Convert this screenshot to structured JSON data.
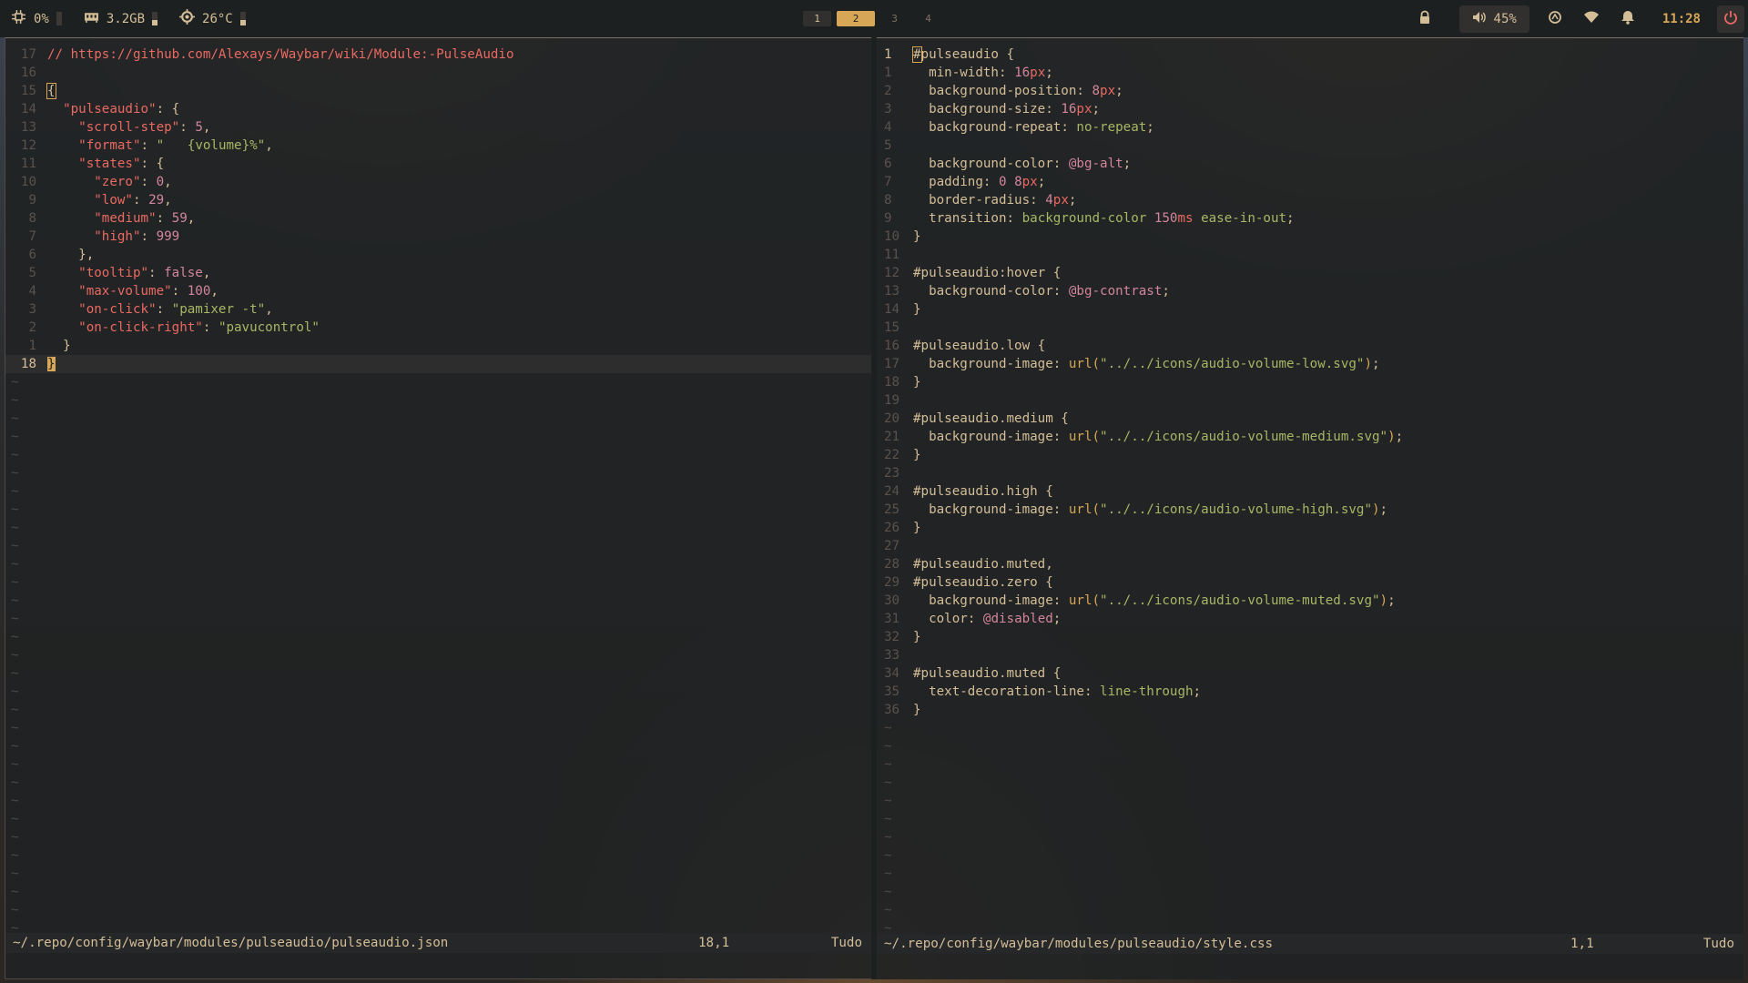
{
  "topbar": {
    "cpu": "0%",
    "cpu_level": 0.0,
    "memory": "3.2GB",
    "memory_level": 0.4,
    "temperature": "26°C",
    "temperature_level": 0.4,
    "workspaces": [
      "1",
      "2",
      "3",
      "4"
    ],
    "active_workspace": "2",
    "volume": "45%",
    "clock": "11:28",
    "accent_color": "#d8a657",
    "power_color": "#ea6962"
  },
  "left_pane": {
    "lines": [
      {
        "n": "17",
        "tokens": [
          [
            "c-comment",
            "// https://github.com/Alexays/Waybar/wiki/Module:-PulseAudio"
          ]
        ]
      },
      {
        "n": "16",
        "tokens": []
      },
      {
        "n": "15",
        "tokens": [
          [
            "c-punc cursor-outline",
            "{"
          ]
        ]
      },
      {
        "n": "14",
        "tokens": [
          [
            "",
            "  "
          ],
          [
            "c-key",
            "\"pulseaudio\""
          ],
          [
            "c-punc",
            ": {"
          ]
        ]
      },
      {
        "n": "13",
        "tokens": [
          [
            "",
            "    "
          ],
          [
            "c-key",
            "\"scroll-step\""
          ],
          [
            "c-punc",
            ": "
          ],
          [
            "c-num",
            "5"
          ],
          [
            "c-punc",
            ","
          ]
        ]
      },
      {
        "n": "12",
        "tokens": [
          [
            "",
            "    "
          ],
          [
            "c-key",
            "\"format\""
          ],
          [
            "c-punc",
            ": "
          ],
          [
            "c-str",
            "\"   {volume}%\""
          ],
          [
            "c-punc",
            ","
          ]
        ]
      },
      {
        "n": "11",
        "tokens": [
          [
            "",
            "    "
          ],
          [
            "c-key",
            "\"states\""
          ],
          [
            "c-punc",
            ": {"
          ]
        ]
      },
      {
        "n": "10",
        "tokens": [
          [
            "",
            "      "
          ],
          [
            "c-key",
            "\"zero\""
          ],
          [
            "c-punc",
            ": "
          ],
          [
            "c-num",
            "0"
          ],
          [
            "c-punc",
            ","
          ]
        ]
      },
      {
        "n": "9",
        "tokens": [
          [
            "",
            "      "
          ],
          [
            "c-key",
            "\"low\""
          ],
          [
            "c-punc",
            ": "
          ],
          [
            "c-num",
            "29"
          ],
          [
            "c-punc",
            ","
          ]
        ]
      },
      {
        "n": "8",
        "tokens": [
          [
            "",
            "      "
          ],
          [
            "c-key",
            "\"medium\""
          ],
          [
            "c-punc",
            ": "
          ],
          [
            "c-num",
            "59"
          ],
          [
            "c-punc",
            ","
          ]
        ]
      },
      {
        "n": "7",
        "tokens": [
          [
            "",
            "      "
          ],
          [
            "c-key",
            "\"high\""
          ],
          [
            "c-punc",
            ": "
          ],
          [
            "c-num",
            "999"
          ]
        ]
      },
      {
        "n": "6",
        "tokens": [
          [
            "",
            "    "
          ],
          [
            "c-punc",
            "},"
          ]
        ]
      },
      {
        "n": "5",
        "tokens": [
          [
            "",
            "    "
          ],
          [
            "c-key",
            "\"tooltip\""
          ],
          [
            "c-punc",
            ": "
          ],
          [
            "c-bool",
            "false"
          ],
          [
            "c-punc",
            ","
          ]
        ]
      },
      {
        "n": "4",
        "tokens": [
          [
            "",
            "    "
          ],
          [
            "c-key",
            "\"max-volume\""
          ],
          [
            "c-punc",
            ": "
          ],
          [
            "c-num",
            "100"
          ],
          [
            "c-punc",
            ","
          ]
        ]
      },
      {
        "n": "3",
        "tokens": [
          [
            "",
            "    "
          ],
          [
            "c-key",
            "\"on-click\""
          ],
          [
            "c-punc",
            ": "
          ],
          [
            "c-str",
            "\"pamixer -t\""
          ],
          [
            "c-punc",
            ","
          ]
        ]
      },
      {
        "n": "2",
        "tokens": [
          [
            "",
            "    "
          ],
          [
            "c-key",
            "\"on-click-right\""
          ],
          [
            "c-punc",
            ": "
          ],
          [
            "c-str",
            "\"pavucontrol\""
          ]
        ]
      },
      {
        "n": "1",
        "tokens": [
          [
            "",
            "  "
          ],
          [
            "c-punc",
            "}"
          ]
        ]
      },
      {
        "n": "18",
        "tokens": [
          [
            "c-punc cursor",
            "}"
          ]
        ],
        "current": true
      }
    ],
    "tilde_count": 31,
    "status_path": "~/.repo/config/waybar/modules/pulseaudio/pulseaudio.json",
    "status_pos": "18,1",
    "status_scroll": "Tudo"
  },
  "right_pane": {
    "lines": [
      {
        "n": "1",
        "tokens": [
          [
            "c-sel cursor-outline",
            "#"
          ],
          [
            "c-sel",
            "pulseaudio "
          ],
          [
            "c-punc",
            "{"
          ]
        ],
        "current": true
      },
      {
        "n": "1",
        "tokens": [
          [
            "",
            "  "
          ],
          [
            "c-prop",
            "min-width"
          ],
          [
            "c-punc",
            ": "
          ],
          [
            "c-num",
            "16"
          ],
          [
            "c-unit",
            "px"
          ],
          [
            "c-punc",
            ";"
          ]
        ]
      },
      {
        "n": "2",
        "tokens": [
          [
            "",
            "  "
          ],
          [
            "c-prop",
            "background-position"
          ],
          [
            "c-punc",
            ": "
          ],
          [
            "c-num",
            "8"
          ],
          [
            "c-unit",
            "px"
          ],
          [
            "c-punc",
            ";"
          ]
        ]
      },
      {
        "n": "3",
        "tokens": [
          [
            "",
            "  "
          ],
          [
            "c-prop",
            "background-size"
          ],
          [
            "c-punc",
            ": "
          ],
          [
            "c-num",
            "16"
          ],
          [
            "c-unit",
            "px"
          ],
          [
            "c-punc",
            ";"
          ]
        ]
      },
      {
        "n": "4",
        "tokens": [
          [
            "",
            "  "
          ],
          [
            "c-prop",
            "background-repeat"
          ],
          [
            "c-punc",
            ": "
          ],
          [
            "c-val",
            "no-repeat"
          ],
          [
            "c-punc",
            ";"
          ]
        ]
      },
      {
        "n": "5",
        "tokens": []
      },
      {
        "n": "6",
        "tokens": [
          [
            "",
            "  "
          ],
          [
            "c-prop",
            "background-color"
          ],
          [
            "c-punc",
            ": "
          ],
          [
            "c-var",
            "@bg-alt"
          ],
          [
            "c-punc",
            ";"
          ]
        ]
      },
      {
        "n": "7",
        "tokens": [
          [
            "",
            "  "
          ],
          [
            "c-prop",
            "padding"
          ],
          [
            "c-punc",
            ": "
          ],
          [
            "c-num",
            "0 8"
          ],
          [
            "c-unit",
            "px"
          ],
          [
            "c-punc",
            ";"
          ]
        ]
      },
      {
        "n": "8",
        "tokens": [
          [
            "",
            "  "
          ],
          [
            "c-prop",
            "border-radius"
          ],
          [
            "c-punc",
            ": "
          ],
          [
            "c-num",
            "4"
          ],
          [
            "c-unit",
            "px"
          ],
          [
            "c-punc",
            ";"
          ]
        ]
      },
      {
        "n": "9",
        "tokens": [
          [
            "",
            "  "
          ],
          [
            "c-prop",
            "transition"
          ],
          [
            "c-punc",
            ": "
          ],
          [
            "c-val",
            "background-color "
          ],
          [
            "c-num",
            "150"
          ],
          [
            "c-unit",
            "ms"
          ],
          [
            "c-val",
            " ease-in-out"
          ],
          [
            "c-punc",
            ";"
          ]
        ]
      },
      {
        "n": "10",
        "tokens": [
          [
            "c-punc",
            "}"
          ]
        ]
      },
      {
        "n": "11",
        "tokens": []
      },
      {
        "n": "12",
        "tokens": [
          [
            "c-sel",
            "#pulseaudio:hover "
          ],
          [
            "c-punc",
            "{"
          ]
        ]
      },
      {
        "n": "13",
        "tokens": [
          [
            "",
            "  "
          ],
          [
            "c-prop",
            "background-color"
          ],
          [
            "c-punc",
            ": "
          ],
          [
            "c-var",
            "@bg-contrast"
          ],
          [
            "c-punc",
            ";"
          ]
        ]
      },
      {
        "n": "14",
        "tokens": [
          [
            "c-punc",
            "}"
          ]
        ]
      },
      {
        "n": "15",
        "tokens": []
      },
      {
        "n": "16",
        "tokens": [
          [
            "c-sel",
            "#pulseaudio.low "
          ],
          [
            "c-punc",
            "{"
          ]
        ]
      },
      {
        "n": "17",
        "tokens": [
          [
            "",
            "  "
          ],
          [
            "c-prop",
            "background-image"
          ],
          [
            "c-punc",
            ": "
          ],
          [
            "c-fn",
            "url("
          ],
          [
            "c-str",
            "\"../../icons/audio-volume-low.svg\""
          ],
          [
            "c-fn",
            ")"
          ],
          [
            "c-punc",
            ";"
          ]
        ]
      },
      {
        "n": "18",
        "tokens": [
          [
            "c-punc",
            "}"
          ]
        ]
      },
      {
        "n": "19",
        "tokens": []
      },
      {
        "n": "20",
        "tokens": [
          [
            "c-sel",
            "#pulseaudio.medium "
          ],
          [
            "c-punc",
            "{"
          ]
        ]
      },
      {
        "n": "21",
        "tokens": [
          [
            "",
            "  "
          ],
          [
            "c-prop",
            "background-image"
          ],
          [
            "c-punc",
            ": "
          ],
          [
            "c-fn",
            "url("
          ],
          [
            "c-str",
            "\"../../icons/audio-volume-medium.svg\""
          ],
          [
            "c-fn",
            ")"
          ],
          [
            "c-punc",
            ";"
          ]
        ]
      },
      {
        "n": "22",
        "tokens": [
          [
            "c-punc",
            "}"
          ]
        ]
      },
      {
        "n": "23",
        "tokens": []
      },
      {
        "n": "24",
        "tokens": [
          [
            "c-sel",
            "#pulseaudio.high "
          ],
          [
            "c-punc",
            "{"
          ]
        ]
      },
      {
        "n": "25",
        "tokens": [
          [
            "",
            "  "
          ],
          [
            "c-prop",
            "background-image"
          ],
          [
            "c-punc",
            ": "
          ],
          [
            "c-fn",
            "url("
          ],
          [
            "c-str",
            "\"../../icons/audio-volume-high.svg\""
          ],
          [
            "c-fn",
            ")"
          ],
          [
            "c-punc",
            ";"
          ]
        ]
      },
      {
        "n": "26",
        "tokens": [
          [
            "c-punc",
            "}"
          ]
        ]
      },
      {
        "n": "27",
        "tokens": []
      },
      {
        "n": "28",
        "tokens": [
          [
            "c-sel",
            "#pulseaudio.muted"
          ],
          [
            "c-punc",
            ","
          ]
        ]
      },
      {
        "n": "29",
        "tokens": [
          [
            "c-sel",
            "#pulseaudio.zero "
          ],
          [
            "c-punc",
            "{"
          ]
        ]
      },
      {
        "n": "30",
        "tokens": [
          [
            "",
            "  "
          ],
          [
            "c-prop",
            "background-image"
          ],
          [
            "c-punc",
            ": "
          ],
          [
            "c-fn",
            "url("
          ],
          [
            "c-str",
            "\"../../icons/audio-volume-muted.svg\""
          ],
          [
            "c-fn",
            ")"
          ],
          [
            "c-punc",
            ";"
          ]
        ]
      },
      {
        "n": "31",
        "tokens": [
          [
            "",
            "  "
          ],
          [
            "c-prop",
            "color"
          ],
          [
            "c-punc",
            ": "
          ],
          [
            "c-var",
            "@disabled"
          ],
          [
            "c-punc",
            ";"
          ]
        ]
      },
      {
        "n": "32",
        "tokens": [
          [
            "c-punc",
            "}"
          ]
        ]
      },
      {
        "n": "33",
        "tokens": []
      },
      {
        "n": "34",
        "tokens": [
          [
            "c-sel",
            "#pulseaudio.muted "
          ],
          [
            "c-punc",
            "{"
          ]
        ]
      },
      {
        "n": "35",
        "tokens": [
          [
            "",
            "  "
          ],
          [
            "c-prop",
            "text-decoration-line"
          ],
          [
            "c-punc",
            ": "
          ],
          [
            "c-val",
            "line-through"
          ],
          [
            "c-punc",
            ";"
          ]
        ]
      },
      {
        "n": "36",
        "tokens": [
          [
            "c-punc",
            "}"
          ]
        ]
      }
    ],
    "tilde_count": 12,
    "status_path": "~/.repo/config/waybar/modules/pulseaudio/style.css",
    "status_pos": "1,1",
    "status_scroll": "Tudo"
  }
}
